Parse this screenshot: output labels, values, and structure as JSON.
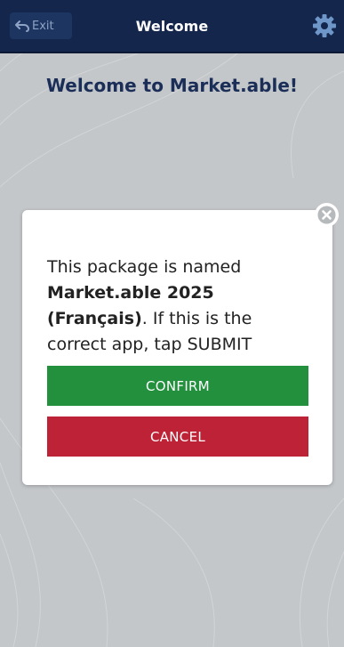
{
  "header": {
    "exit_label": "Exit",
    "title": "Welcome"
  },
  "main": {
    "heading": "Welcome to Market.able!"
  },
  "dialog": {
    "message_intro": "This package is named ",
    "package_name": "Market.able 2025 (Français)",
    "message_outro": ". If this is the correct app, tap SUBMIT",
    "confirm_label": "CONFIRM",
    "cancel_label": "CANCEL"
  },
  "colors": {
    "header_bg": "#14264b",
    "confirm": "#22903d",
    "cancel": "#bd2236",
    "heading_text": "#1b2e57"
  },
  "icons": {
    "exit": "undo-arrow-icon",
    "settings": "gear-icon",
    "close": "close-circle-icon"
  }
}
